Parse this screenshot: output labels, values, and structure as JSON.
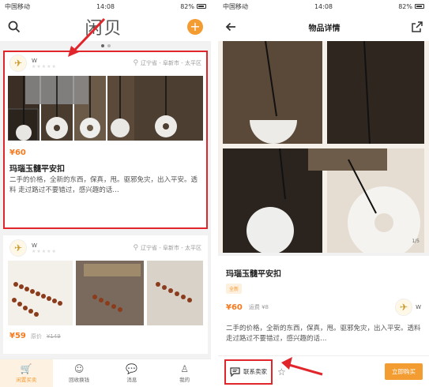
{
  "status": {
    "carrier": "中国移动",
    "time": "14:08",
    "battery": "82%"
  },
  "left": {
    "logo": "闲贝",
    "card1": {
      "user": "W",
      "location": "辽宁省 - 阜新市 - 太平区",
      "price": "¥60",
      "title": "玛瑙玉髓平安扣",
      "desc": "二手的价格，全新的东西，保真，甩。驱邪免灾，出入平安。透料 走过路过不要错过，感兴趣的话…"
    },
    "card2": {
      "user": "W",
      "location": "辽宁省 - 阜新市 - 太平区",
      "price": "¥59",
      "orig_label": "原价",
      "orig_price": "¥149"
    },
    "tabs": [
      "闲置买卖",
      "回收换钱",
      "消息",
      "我的"
    ]
  },
  "right": {
    "title": "物品详情",
    "counter": "1/5",
    "item_title": "玛瑙玉髓平安扣",
    "tag": "全新",
    "price": "¥60",
    "freight": "运费 ¥8",
    "seller": "W",
    "desc": "二手的价格，全新的东西，保真，甩。驱邪免灾，出入平安。透料 走过路过不要错过，感兴趣的话…",
    "contact": "联系卖家",
    "buy": "立即购买"
  },
  "colors": {
    "accent": "#f39c32",
    "price": "#f47a20",
    "highlight": "#e0262b"
  }
}
